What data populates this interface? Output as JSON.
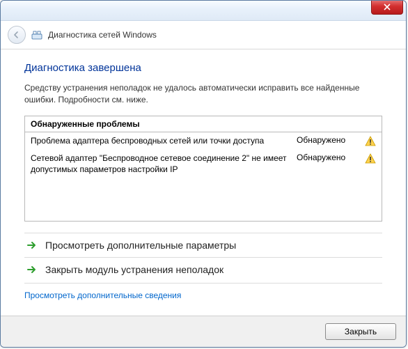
{
  "window": {
    "title": "Диагностика сетей Windows"
  },
  "main": {
    "heading": "Диагностика завершена",
    "subtext": "Средству устранения неполадок не удалось автоматически исправить все найденные ошибки. Подробности см. ниже.",
    "problems_header": "Обнаруженные проблемы",
    "problems": [
      {
        "text": "Проблема адаптера беспроводных сетей или точки доступа",
        "status": "Обнаружено"
      },
      {
        "text": "Сетевой адаптер \"Беспроводное сетевое соединение 2\" не имеет допустимых параметров настройки IP",
        "status": "Обнаружено"
      }
    ],
    "options": {
      "view_params": "Просмотреть дополнительные параметры",
      "close_module": "Закрыть модуль устранения неполадок"
    },
    "details_link": "Просмотреть дополнительные сведения"
  },
  "footer": {
    "close_btn": "Закрыть"
  }
}
